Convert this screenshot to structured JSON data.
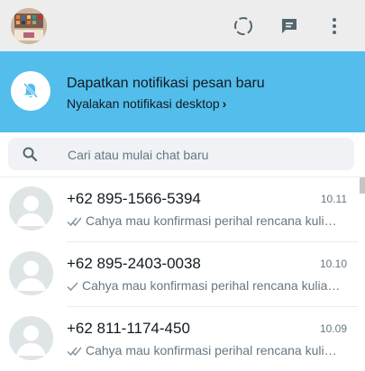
{
  "header": {
    "avatar_icon": "user-profile-picture",
    "status_icon": "status-ring-icon",
    "new_chat_icon": "new-chat-icon",
    "menu_icon": "kebab-menu-icon"
  },
  "notification": {
    "title": "Dapatkan notifikasi pesan baru",
    "link_label": "Nyalakan notifikasi desktop",
    "link_chevron": "›",
    "icon": "bell-off-icon",
    "banner_color": "#53bdeb"
  },
  "search": {
    "placeholder": "Cari atau mulai chat baru",
    "icon": "search-icon"
  },
  "chats": [
    {
      "name": "+62 895-1566-5394",
      "time": "10.11",
      "status": "double-check-icon",
      "preview": "Cahya mau konfirmasi perihal rencana kuliah..."
    },
    {
      "name": "+62 895-2403-0038",
      "time": "10.10",
      "status": "single-check-icon",
      "preview": "Cahya mau konfirmasi perihal rencana kuliah..."
    },
    {
      "name": "+62 811-1174-450",
      "time": "10.09",
      "status": "double-check-icon",
      "preview": "Cahya mau konfirmasi perihal rencana kuliah..."
    }
  ]
}
